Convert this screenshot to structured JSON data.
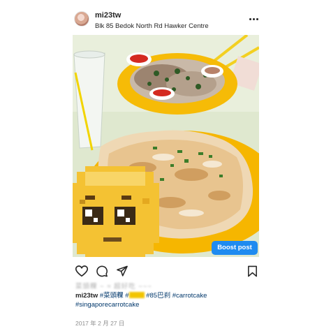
{
  "post": {
    "username": "mi23tw",
    "location": "Blk 85 Bedok North Rd Hawker Centre",
    "boost_label": "Boost post",
    "caption": {
      "hidden_line": "菜頭粿 ~ ≈ 超好吃 ~~~",
      "user": "mi23tw",
      "tag_1": "#菜頭粿",
      "tag_2": "#85巴刹",
      "tag_3": "#carrotcake",
      "tag_4": "#singaporecarrotcake"
    },
    "timestamp": "2017 年 2 月 27 日"
  },
  "icons": {
    "more": "more-options-icon",
    "like": "heart-icon",
    "comment": "comment-icon",
    "share": "share-icon",
    "save": "bookmark-icon"
  },
  "colors": {
    "accent": "#1f8bf0",
    "text": "#262626",
    "tag": "#00376b",
    "muted": "#8e8e8e"
  }
}
